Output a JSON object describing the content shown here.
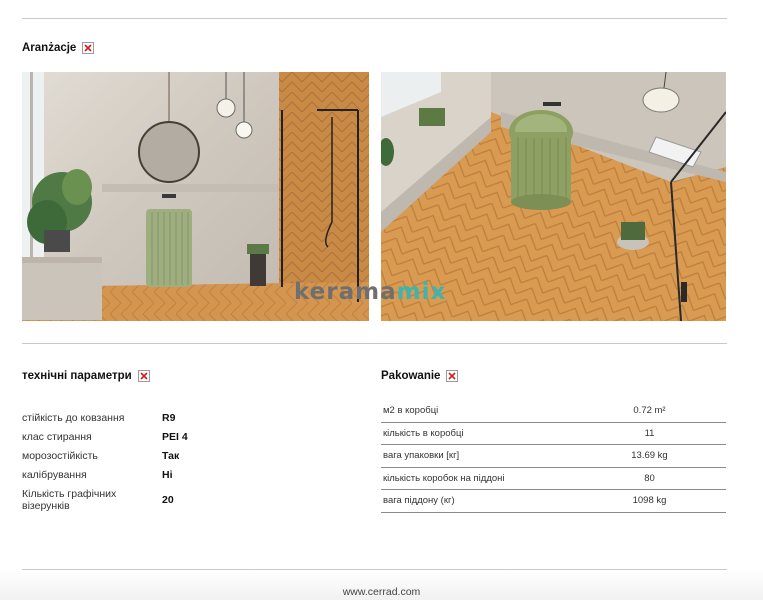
{
  "arrangements": {
    "title": "Aranżacje"
  },
  "tech_params": {
    "title": "технічні параметри",
    "rows": [
      {
        "label": "стійкість до ковзання",
        "value": "R9"
      },
      {
        "label": "клас стирання",
        "value": "PEI 4"
      },
      {
        "label": "морозостійкість",
        "value": "Так"
      },
      {
        "label": "калібрування",
        "value": "Hi"
      },
      {
        "label": "Кількість графічних візерунків",
        "value": "20"
      }
    ]
  },
  "packaging": {
    "title": "Pakowanie",
    "rows": [
      {
        "label": "м2 в коробці",
        "value": "0.72 m²"
      },
      {
        "label": "кількість в коробці",
        "value": "11"
      },
      {
        "label": "вага упаковки [кг]",
        "value": "13.69 kg"
      },
      {
        "label": "кількість коробок на піддоні",
        "value": "80"
      },
      {
        "label": "вага піддону (кг)",
        "value": "1098 kg"
      }
    ]
  },
  "watermark": {
    "part1": "kerama",
    "part2": "mix",
    "color1": "#6f6f6f",
    "color2": "#3bb5b0"
  },
  "footer": {
    "url": "www.cerrad.com"
  },
  "colors": {
    "wood": "#c98a45",
    "concrete": "#d4cec6",
    "sage": "#8fa06a",
    "rule": "#c9c9c9"
  }
}
